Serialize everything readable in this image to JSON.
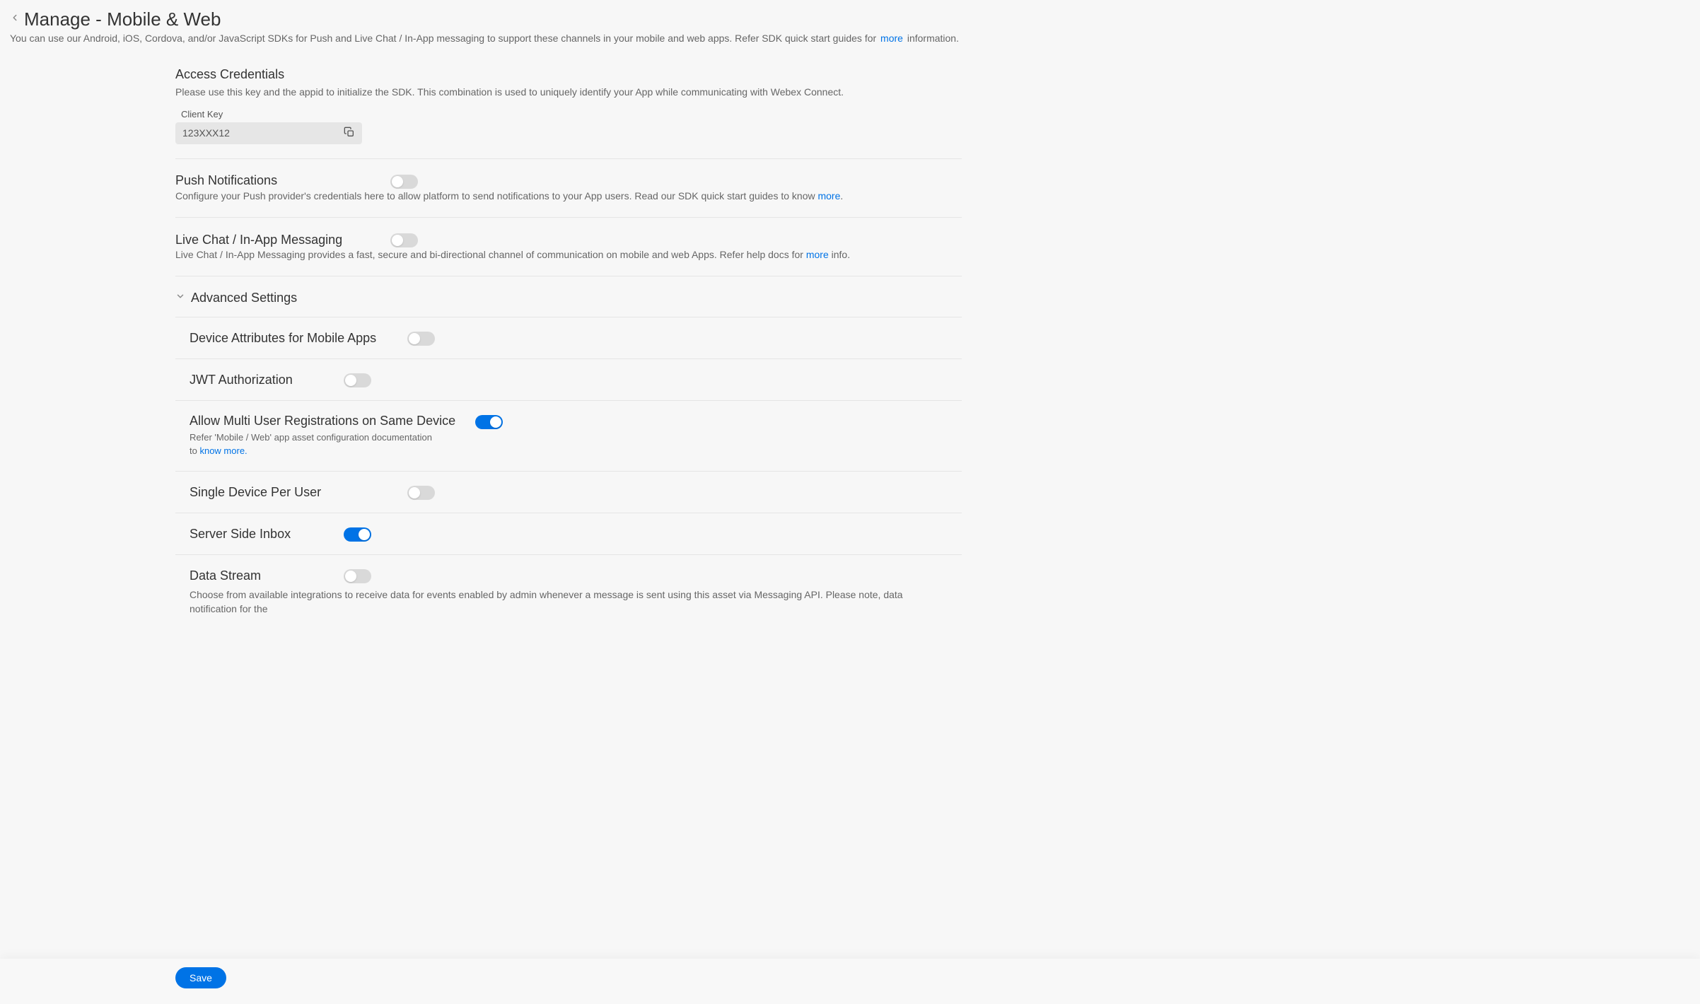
{
  "header": {
    "title": "Manage - Mobile & Web",
    "sub_a": "You can use our Android, iOS, Cordova, and/or JavaScript SDKs for Push and Live Chat / In-App messaging to support these channels in your mobile and web apps. Refer SDK quick start guides for ",
    "sub_link": "more",
    "sub_b": " information."
  },
  "access": {
    "title": "Access Credentials",
    "desc": "Please use this key and the appid to initialize the SDK. This combination is used to uniquely identify your App while communicating with Webex Connect.",
    "client_key_label": "Client Key",
    "client_key_value": "123XXX12"
  },
  "push": {
    "title": "Push Notifications",
    "desc_a": "Configure your Push provider's credentials here to allow platform to send notifications to your App users. Read our SDK quick start guides to know ",
    "link": "more",
    "desc_b": "."
  },
  "live": {
    "title": "Live Chat / In-App Messaging",
    "desc_a": "Live Chat / In-App Messaging provides a fast, secure and bi-directional channel of communication on mobile and web Apps. Refer help docs for ",
    "link": "more",
    "desc_b": " info."
  },
  "adv": {
    "title": "Advanced Settings",
    "device_attr": "Device Attributes for Mobile Apps",
    "jwt": "JWT Authorization",
    "multi": {
      "title": "Allow Multi User Registrations on Same Device",
      "desc_a": "Refer 'Mobile / Web' app asset configuration documentation to ",
      "link": "know more."
    },
    "single": "Single Device Per User",
    "server_inbox": "Server Side Inbox",
    "data_stream": {
      "title": "Data Stream",
      "desc": "Choose from available integrations to receive data for events enabled by admin whenever a message is sent using this asset via Messaging API. Please note, data notification for the"
    }
  },
  "save": "Save"
}
